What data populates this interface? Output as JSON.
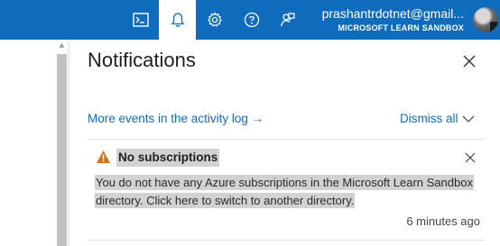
{
  "topbar": {
    "icons": [
      "cloud-shell-icon",
      "notifications-icon",
      "settings-icon",
      "help-icon",
      "feedback-icon"
    ],
    "account_email": "prashantrdotnet@gmail...",
    "account_tenant": "MICROSOFT LEARN SANDBOX",
    "accent_color": "#0f6cbd"
  },
  "panel": {
    "title": "Notifications",
    "activity_link": "More events in the activity log",
    "activity_arrow": "→",
    "dismiss_label": "Dismiss all"
  },
  "notification": {
    "title": "No subscriptions",
    "body_line1": "You do not have any Azure subscriptions in the Microsoft Learn Sandbox",
    "body_line2": "directory. Click here to switch to another directory.",
    "timestamp": "6 minutes ago",
    "status_color": "#d9700b"
  }
}
